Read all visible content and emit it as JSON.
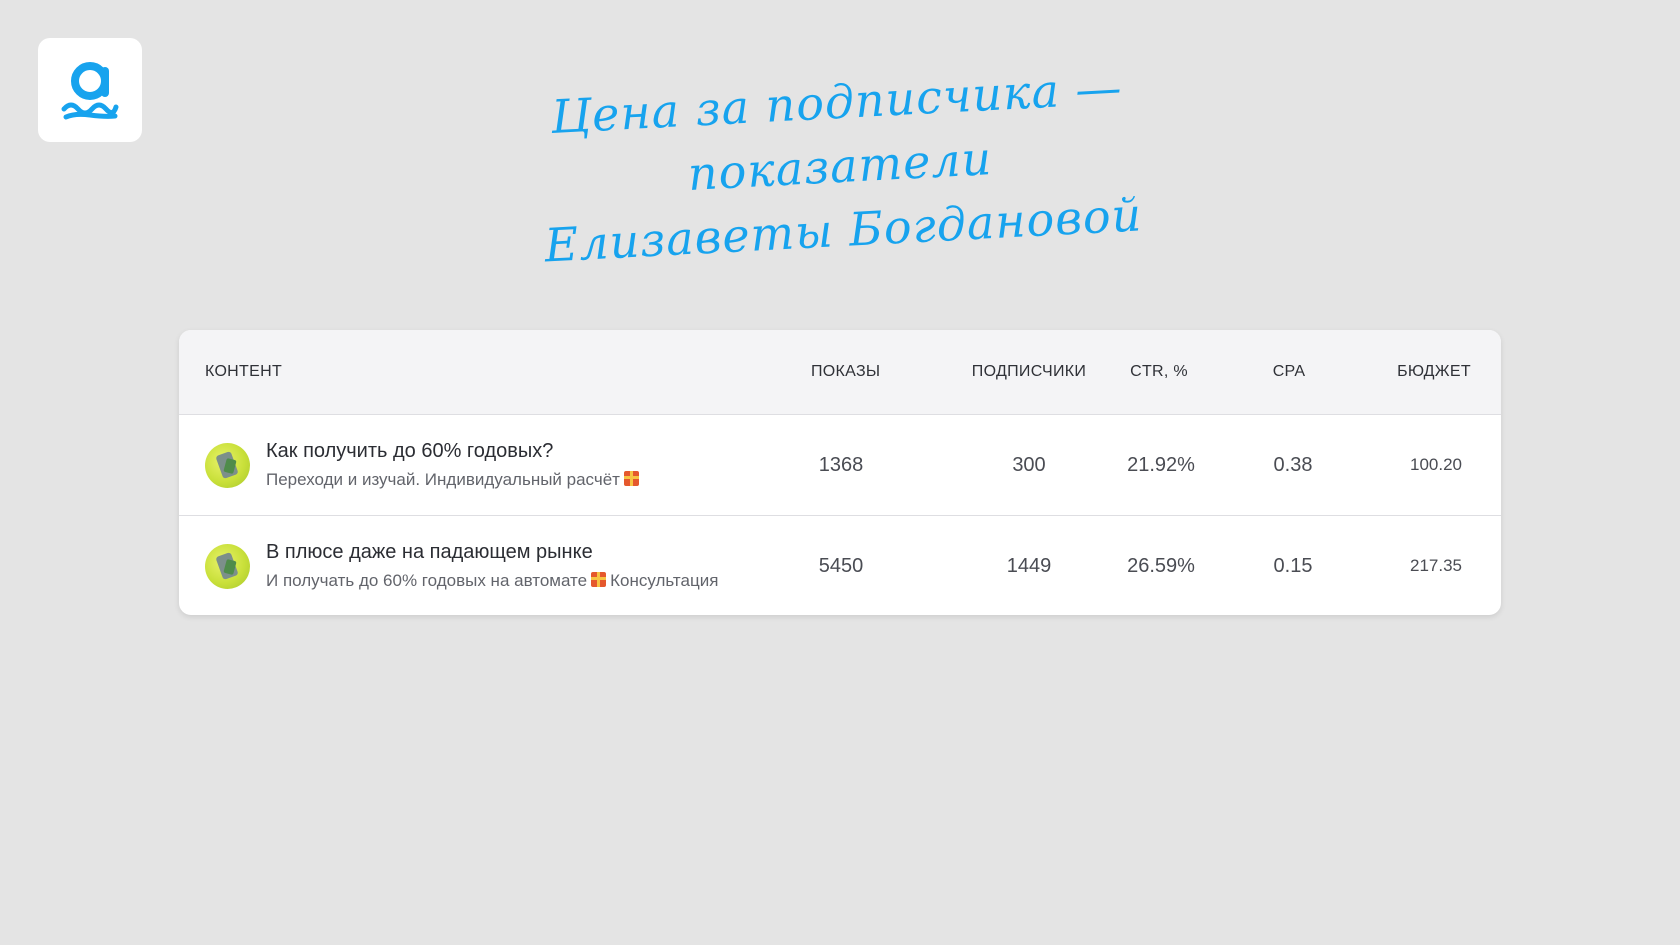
{
  "header": {
    "title_line1": "Цена за подписчика — показатели",
    "title_line2": "Елизаветы Богдановой",
    "accent_color": "#17a3ee"
  },
  "logo": {
    "letter": "a"
  },
  "table": {
    "columns": [
      "КОНТЕНТ",
      "ПОКАЗЫ",
      "ПОДПИСЧИКИ",
      "CTR, %",
      "CPA",
      "БЮДЖЕТ"
    ],
    "rows": [
      {
        "title": "Как получить до 60% годовых?",
        "subtitle_before": "Переходи и изучай. Индивидуальный расчёт",
        "subtitle_after": "",
        "impressions": "1368",
        "subscribers": "300",
        "ctr": "21.92%",
        "cpa": "0.38",
        "budget": "100.20"
      },
      {
        "title": "В плюсе даже на падающем рынке",
        "subtitle_before": "И получать до 60% годовых на автомате",
        "subtitle_after": "Консультация",
        "impressions": "5450",
        "subscribers": "1449",
        "ctr": "26.59%",
        "cpa": "0.15",
        "budget": "217.35"
      }
    ]
  }
}
